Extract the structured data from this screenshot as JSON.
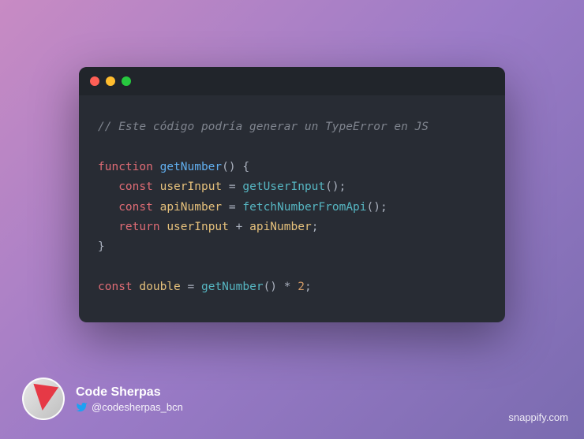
{
  "window": {
    "dots": {
      "red": "#ff5f56",
      "yellow": "#ffbd2e",
      "green": "#27c93f"
    }
  },
  "code": {
    "comment": "// Este código podría generar un TypeError en JS",
    "kw_function": "function",
    "fn_getNumber": "getNumber",
    "paren_open": "(",
    "paren_close": ")",
    "brace_open": "{",
    "brace_close": "}",
    "kw_const": "const",
    "var_userInput": "userInput",
    "eq": " = ",
    "call_getUserInput": "getUserInput",
    "call_fetchNumberFromApi": "fetchNumberFromApi",
    "semicolon": ";",
    "var_apiNumber": "apiNumber",
    "kw_return": "return",
    "plus": " + ",
    "var_double": "double",
    "star": " * ",
    "num_2": "2"
  },
  "author": {
    "name": "Code Sherpas",
    "handle": "@codesherpas_bcn"
  },
  "watermark": "snappify.com"
}
